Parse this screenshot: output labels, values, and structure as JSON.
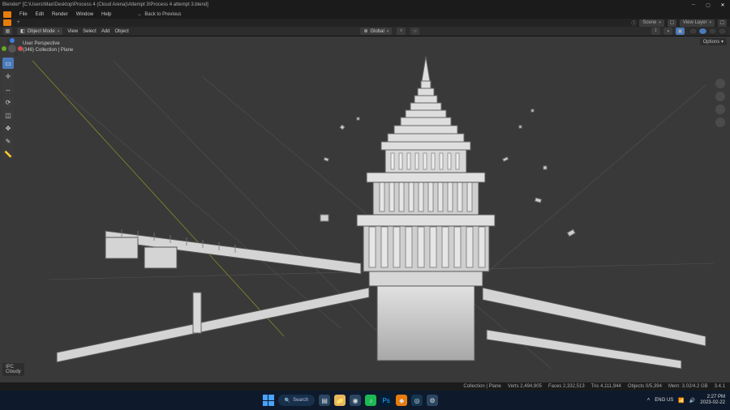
{
  "app": {
    "title": "Blender* [C:\\Users\\Max\\Desktop\\Process 4 (Cloud Arena)\\Attempt 3\\Process 4 attempt 3.blend]"
  },
  "menu": {
    "items": [
      "File",
      "Edit",
      "Render",
      "Window",
      "Help"
    ],
    "back": "Back to Previous"
  },
  "workspace": {
    "plus": "+"
  },
  "scene_picker": {
    "label": "Scene"
  },
  "viewlayer_picker": {
    "label": "View Layer"
  },
  "vpheader": {
    "editor_icon": "cube-icon",
    "mode": "Object Mode",
    "menus": [
      "View",
      "Select",
      "Add",
      "Object"
    ],
    "orientation": "Global",
    "options_label": "Options"
  },
  "overlay": {
    "line1": "User Perspective",
    "line2": "(346) Collection | Plane"
  },
  "npanel": {
    "line1": "IPC",
    "line2": "Cloudy"
  },
  "toolbar": {
    "tools": [
      "select",
      "cursor",
      "move",
      "rotate",
      "scale",
      "transform",
      "annotate",
      "measure"
    ]
  },
  "statusbar": {
    "collection": "Collection | Plane",
    "verts": "Verts 2,494,905",
    "faces": "Faces 2,332,513",
    "tris": "Tris 4,111,944",
    "objects": "Objects 0/5,394",
    "memory": "Mem: 3.02/4.2 GB",
    "version": "3.4.1"
  },
  "taskbar": {
    "search_placeholder": "Search",
    "lang": "ENG US",
    "time": "2:27 PM",
    "date": "2023-02-22"
  },
  "colors": {
    "accent": "#e87d0d",
    "panel": "#232323",
    "viewport": "#393939",
    "blue": "#4a79b8"
  }
}
